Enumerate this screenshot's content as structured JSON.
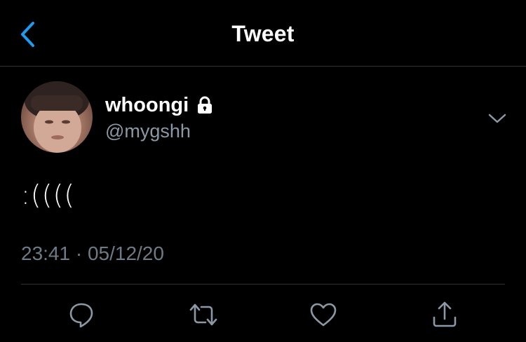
{
  "header": {
    "title": "Tweet",
    "back_icon": "chevron-left-icon",
    "accent_color": "#1d9bf0"
  },
  "tweet": {
    "display_name": "whoongi",
    "handle": "@mygshh",
    "protected": true,
    "lock_icon": "lock-icon",
    "text": ":((((",
    "timestamp": "23:41 · 05/12/20",
    "more_icon": "chevron-down-icon"
  },
  "actions": [
    {
      "name": "reply",
      "icon": "speech-bubble-icon"
    },
    {
      "name": "retweet",
      "icon": "retweet-icon"
    },
    {
      "name": "like",
      "icon": "heart-icon"
    },
    {
      "name": "share",
      "icon": "share-icon"
    }
  ],
  "colors": {
    "background": "#000000",
    "secondary_text": "#8b98a5",
    "icon_gray": "#8b98a5",
    "divider": "#2f3336"
  }
}
